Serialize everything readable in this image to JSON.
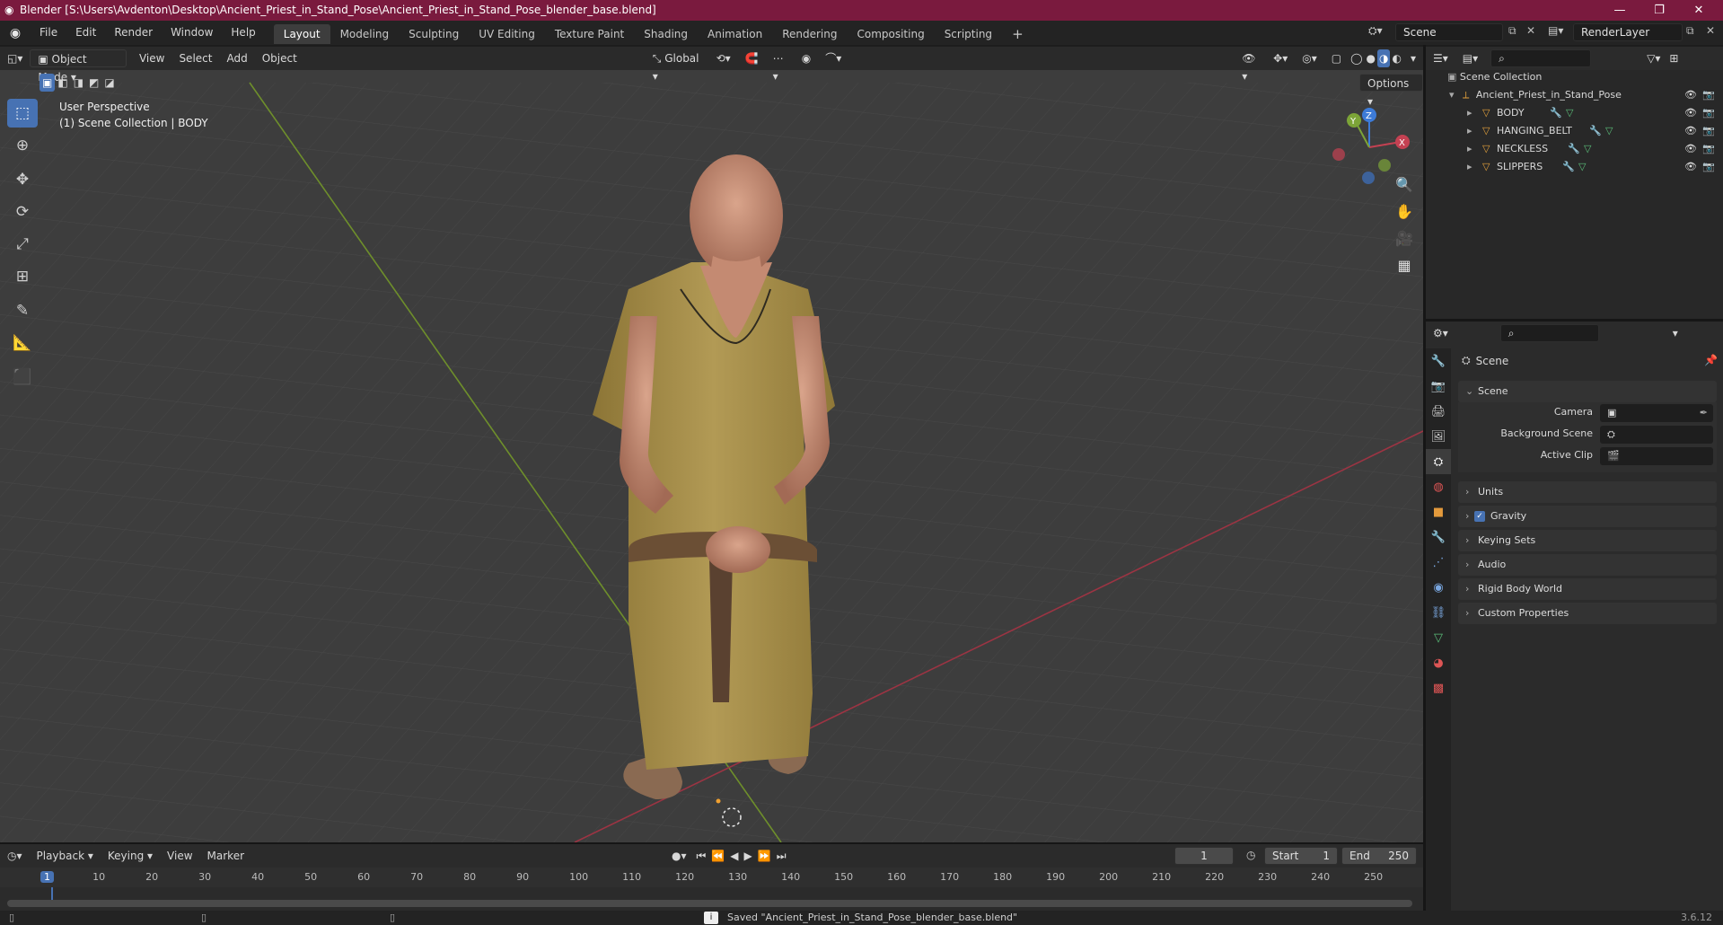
{
  "window": {
    "title": "Blender [S:\\Users\\Avdenton\\Desktop\\Ancient_Priest_in_Stand_Pose\\Ancient_Priest_in_Stand_Pose_blender_base.blend]",
    "accent": "#7a1a3e"
  },
  "menu": [
    "File",
    "Edit",
    "Render",
    "Window",
    "Help"
  ],
  "workspaces": [
    "Layout",
    "Modeling",
    "Sculpting",
    "UV Editing",
    "Texture Paint",
    "Shading",
    "Animation",
    "Rendering",
    "Compositing",
    "Scripting"
  ],
  "active_workspace": "Layout",
  "scene_field": "Scene",
  "renderlayer_field": "RenderLayer",
  "viewport": {
    "mode": "Object Mode",
    "menus": [
      "View",
      "Select",
      "Add",
      "Object"
    ],
    "transform_orientation": "Global",
    "options_label": "Options",
    "overlay_line1": "User Perspective",
    "overlay_line2": "(1) Scene Collection | BODY",
    "gizmo_axes": [
      "X",
      "Y",
      "Z"
    ],
    "x_axis_color": "#c44152",
    "y_axis_color": "#7ca437",
    "z_axis_color": "#3d7bd8"
  },
  "outliner": {
    "root": "Scene Collection",
    "collection": "Ancient_Priest_in_Stand_Pose",
    "objects": [
      "BODY",
      "HANGING_BELT",
      "NECKLESS",
      "SLIPPERS"
    ]
  },
  "properties": {
    "context_title": "Scene",
    "section_title": "Scene",
    "fields": {
      "camera": "Camera",
      "background_scene": "Background Scene",
      "active_clip": "Active Clip"
    },
    "panels": [
      "Units",
      "Gravity",
      "Keying Sets",
      "Audio",
      "Rigid Body World",
      "Custom Properties"
    ],
    "gravity_checked": true
  },
  "timeline": {
    "menus": [
      "Playback",
      "Keying",
      "View",
      "Marker"
    ],
    "current_frame": "1",
    "start_label": "Start",
    "start_value": "1",
    "end_label": "End",
    "end_value": "250",
    "ruler": [
      "1",
      "10",
      "20",
      "30",
      "40",
      "50",
      "60",
      "70",
      "80",
      "90",
      "100",
      "110",
      "120",
      "130",
      "140",
      "150",
      "160",
      "170",
      "180",
      "190",
      "200",
      "210",
      "220",
      "230",
      "240",
      "250"
    ]
  },
  "status": {
    "message": "Saved \"Ancient_Priest_in_Stand_Pose_blender_base.blend\"",
    "version": "3.6.12"
  }
}
